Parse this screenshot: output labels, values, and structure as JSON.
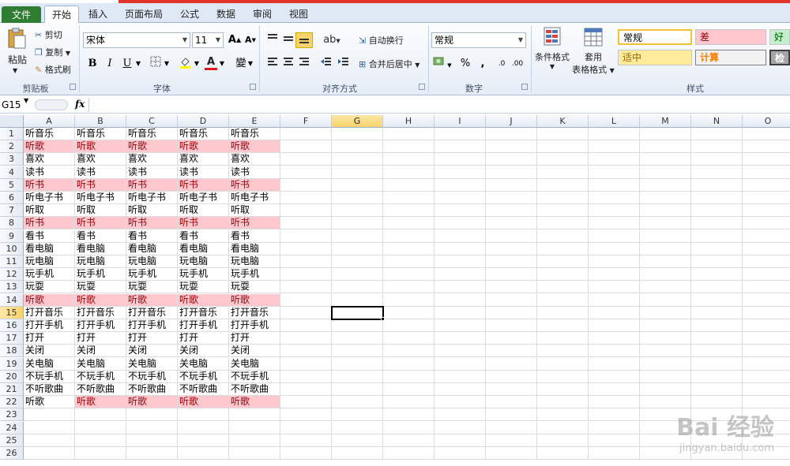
{
  "tabs": {
    "file": "文件",
    "home": "开始",
    "insert": "插入",
    "page_layout": "页面布局",
    "formulas": "公式",
    "data": "数据",
    "review": "审阅",
    "view": "视图"
  },
  "ribbon": {
    "clipboard": {
      "label": "剪贴板",
      "paste": "粘贴",
      "cut": "剪切",
      "copy": "复制",
      "format_painter": "格式刷"
    },
    "font": {
      "label": "字体",
      "name": "宋体",
      "size": "11",
      "bold": "B",
      "italic": "I",
      "underline": "U",
      "phonetic": "變"
    },
    "alignment": {
      "label": "对齐方式",
      "wrap_text": "自动换行",
      "merge_center": "合并后居中"
    },
    "number": {
      "label": "数字",
      "format": "常规",
      "percent": "%",
      "comma": ","
    },
    "styles": {
      "label": "样式",
      "conditional_format": "条件格式",
      "format_as_table_line1": "套用",
      "format_as_table_line2": "表格格式",
      "normal": "常规",
      "bad": "差",
      "good": "好",
      "neutral": "适中",
      "calculation": "计算",
      "check_cell": "检查"
    }
  },
  "formula_bar": {
    "name_box": "G15",
    "fx": "fx",
    "content": ""
  },
  "sheet": {
    "columns": [
      "A",
      "B",
      "C",
      "D",
      "E",
      "F",
      "G",
      "H",
      "I",
      "J",
      "K",
      "L",
      "M",
      "N",
      "O"
    ],
    "selected_column": "G",
    "selected_row": 15,
    "rows": [
      {
        "n": "1",
        "cells": [
          "听音乐",
          "听音乐",
          "听音乐",
          "听音乐",
          "听音乐"
        ],
        "highlight": false
      },
      {
        "n": "2",
        "cells": [
          "听歌",
          "听歌",
          "听歌",
          "听歌",
          "听歌"
        ],
        "highlight": true
      },
      {
        "n": "3",
        "cells": [
          "喜欢",
          "喜欢",
          "喜欢",
          "喜欢",
          "喜欢"
        ],
        "highlight": false
      },
      {
        "n": "4",
        "cells": [
          "读书",
          "读书",
          "读书",
          "读书",
          "读书"
        ],
        "highlight": false
      },
      {
        "n": "5",
        "cells": [
          "听书",
          "听书",
          "听书",
          "听书",
          "听书"
        ],
        "highlight": true
      },
      {
        "n": "6",
        "cells": [
          "听电子书",
          "听电子书",
          "听电子书",
          "听电子书",
          "听电子书"
        ],
        "highlight": false
      },
      {
        "n": "7",
        "cells": [
          "听取",
          "听取",
          "听取",
          "听取",
          "听取"
        ],
        "highlight": false
      },
      {
        "n": "8",
        "cells": [
          "听书",
          "听书",
          "听书",
          "听书",
          "听书"
        ],
        "highlight": true
      },
      {
        "n": "9",
        "cells": [
          "看书",
          "看书",
          "看书",
          "看书",
          "看书"
        ],
        "highlight": false
      },
      {
        "n": "10",
        "cells": [
          "看电脑",
          "看电脑",
          "看电脑",
          "看电脑",
          "看电脑"
        ],
        "highlight": false
      },
      {
        "n": "11",
        "cells": [
          "玩电脑",
          "玩电脑",
          "玩电脑",
          "玩电脑",
          "玩电脑"
        ],
        "highlight": false
      },
      {
        "n": "12",
        "cells": [
          "玩手机",
          "玩手机",
          "玩手机",
          "玩手机",
          "玩手机"
        ],
        "highlight": false
      },
      {
        "n": "13",
        "cells": [
          "玩耍",
          "玩耍",
          "玩耍",
          "玩耍",
          "玩耍"
        ],
        "highlight": false
      },
      {
        "n": "14",
        "cells": [
          "听歌",
          "听歌",
          "听歌",
          "听歌",
          "听歌"
        ],
        "highlight": true
      },
      {
        "n": "15",
        "cells": [
          "打开音乐",
          "打开音乐",
          "打开音乐",
          "打开音乐",
          "打开音乐"
        ],
        "highlight": false
      },
      {
        "n": "16",
        "cells": [
          "打开手机",
          "打开手机",
          "打开手机",
          "打开手机",
          "打开手机"
        ],
        "highlight": false
      },
      {
        "n": "17",
        "cells": [
          "打开",
          "打开",
          "打开",
          "打开",
          "打开"
        ],
        "highlight": false
      },
      {
        "n": "18",
        "cells": [
          "关闭",
          "关闭",
          "关闭",
          "关闭",
          "关闭"
        ],
        "highlight": false
      },
      {
        "n": "19",
        "cells": [
          "关电脑",
          "关电脑",
          "关电脑",
          "关电脑",
          "关电脑"
        ],
        "highlight": false
      },
      {
        "n": "20",
        "cells": [
          "不玩手机",
          "不玩手机",
          "不玩手机",
          "不玩手机",
          "不玩手机"
        ],
        "highlight": false
      },
      {
        "n": "21",
        "cells": [
          "不听歌曲",
          "不听歌曲",
          "不听歌曲",
          "不听歌曲",
          "不听歌曲"
        ],
        "highlight": false
      },
      {
        "n": "22",
        "cells": [
          "听歌",
          "听歌",
          "听歌",
          "听歌",
          "听歌"
        ],
        "highlight": "partial"
      },
      {
        "n": "23",
        "cells": [],
        "highlight": false
      },
      {
        "n": "24",
        "cells": [],
        "highlight": false
      },
      {
        "n": "25",
        "cells": [],
        "highlight": false
      },
      {
        "n": "26",
        "cells": [],
        "highlight": false
      }
    ]
  },
  "watermark": {
    "brand": "Bai 经验",
    "url": "jingyan.baidu.com"
  },
  "colors": {
    "bad_fill": "#ffc7ce",
    "bad_text": "#9c0006",
    "file_tab": "#2e7d32",
    "selected_header": "#f8d36b"
  }
}
